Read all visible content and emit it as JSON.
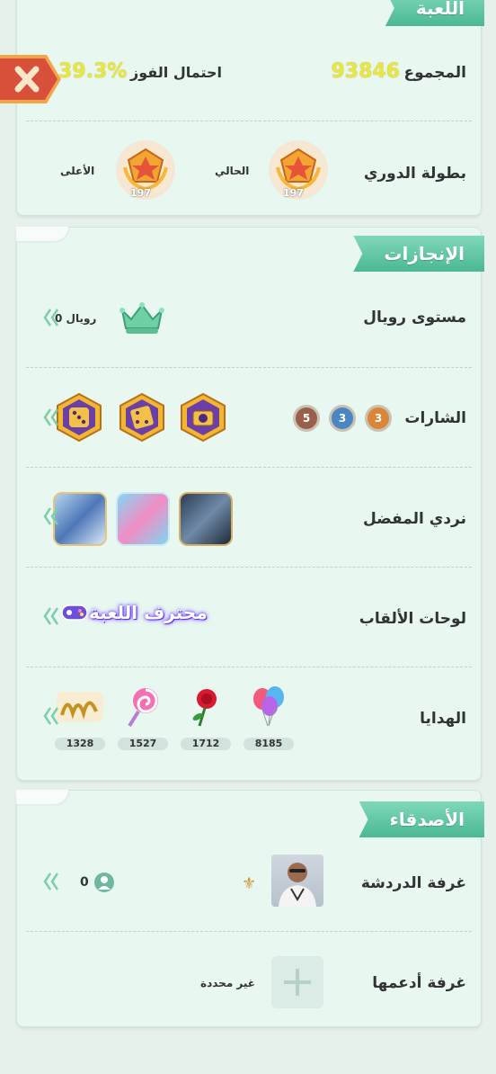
{
  "game_card": {
    "ribbon": "اللعبة",
    "total_label": "المجموع",
    "total_value": "93846",
    "win_prob_label": "احتمال الفوز",
    "win_prob_value": "39.3%",
    "league_label": "بطولة الدوري",
    "current_label": "الحالي",
    "highest_label": "الأعلى",
    "current_level": "197",
    "highest_level": "197"
  },
  "achievements_card": {
    "ribbon": "الإنجازات",
    "royal_label": "مستوى رويال",
    "royal_value": "رويال 0",
    "badges_label": "الشارات",
    "badge_counts": [
      "3",
      "3",
      "5"
    ],
    "favorite_dice_label": "نردي المفضل",
    "title_boards_label": "لوحات الألقاب",
    "title_board_text": "محترف اللعبة",
    "gifts_label": "الهدايا",
    "gifts": [
      {
        "name": "balloons-gift",
        "count": "8185"
      },
      {
        "name": "rose-gift",
        "count": "1712"
      },
      {
        "name": "lollipop-gift",
        "count": "1527"
      },
      {
        "name": "calligraphy-gift",
        "count": "1328"
      }
    ]
  },
  "friends_card": {
    "ribbon": "الأصدقاء",
    "chat_room_label": "غرفة الدردشة",
    "chat_room_count": "0",
    "support_room_label": "غرفة أدعمها",
    "support_room_value": "غير محددة"
  },
  "colors": {
    "accent": "#4bb894",
    "yellow_value": "#e8e640",
    "close_button": "#d9503a"
  }
}
